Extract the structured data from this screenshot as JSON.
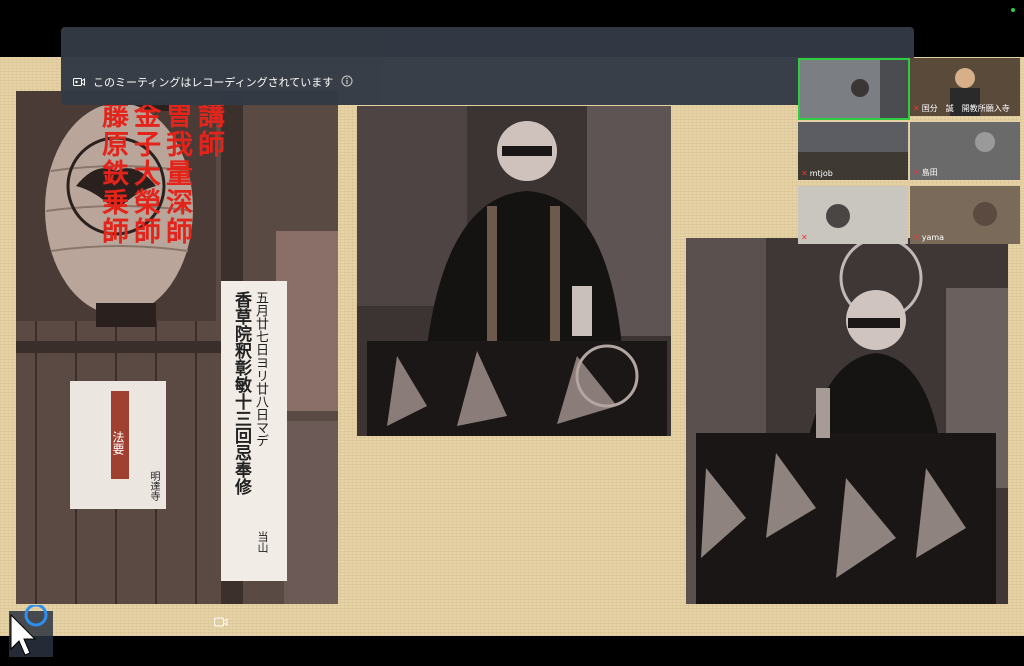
{
  "recording_banner": {
    "text": "このミーティングはレコーディングされています",
    "record_icon": "recording-icon",
    "info_icon": "info-icon"
  },
  "slide": {
    "red_columns": [
      "講師",
      "曽我量深師",
      "金子大榮師",
      "藤原鉄乗師"
    ],
    "sign_text": [
      "五月廿七日ヨリ廿八日マデ",
      "香草院釈彰敏十三回忌奉修",
      "当山"
    ],
    "notice_text": [
      "法要",
      "明達寺"
    ]
  },
  "participants": [
    {
      "name": "",
      "muted": false,
      "active": true
    },
    {
      "name": "国分　誠　開教所願入寺",
      "muted": true,
      "active": false
    },
    {
      "name": "mtjob",
      "muted": true,
      "active": false
    },
    {
      "name": "島田",
      "muted": true,
      "active": false
    },
    {
      "name": "",
      "muted": true,
      "active": false
    },
    {
      "name": "yama",
      "muted": true,
      "active": false
    }
  ],
  "colors": {
    "accent_red": "#e3241b",
    "active_speaker_border": "#2ecc40",
    "banner_bg": "#333a45",
    "slide_bg": "#e6d3a5"
  }
}
